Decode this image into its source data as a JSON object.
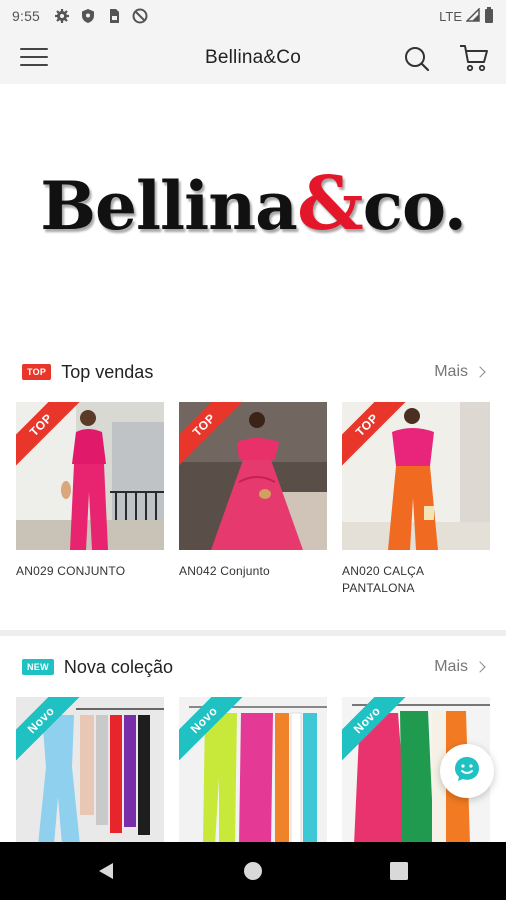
{
  "status_bar": {
    "time": "9:55",
    "network": "LTE",
    "icons": [
      "gear-icon",
      "shield-icon",
      "sim-card-icon",
      "do-not-disturb-icon"
    ]
  },
  "app_bar": {
    "title": "Bellina&Co",
    "menu_icon": "hamburger-menu-icon",
    "search_icon": "search-icon",
    "cart_icon": "shopping-cart-icon"
  },
  "banner": {
    "logo_text_main": "Bellina",
    "logo_text_amp": "&",
    "logo_text_tail": "co.",
    "colors": {
      "text": "#111111",
      "ampersand": "#e3162a"
    }
  },
  "sections": [
    {
      "tag": "TOP",
      "title": "Top vendas",
      "more_label": "Mais",
      "ribbon": "TOP",
      "products": [
        {
          "name": "AN029 CONJUNTO"
        },
        {
          "name": "AN042 Conjunto"
        },
        {
          "name": "AN020 CALÇA PANTALONA"
        }
      ]
    },
    {
      "tag": "NEW",
      "title": "Nova coleção",
      "more_label": "Mais",
      "ribbon": "Novo",
      "products": [
        {
          "name": ""
        },
        {
          "name": ""
        },
        {
          "name": ""
        }
      ]
    }
  ],
  "colors": {
    "top_accent": "#e8362a",
    "new_accent": "#1fc1c3",
    "chat_accent": "#1fc1c3"
  },
  "chat_button": {
    "icon": "chat-bubble-icon"
  },
  "nav_bar": {
    "icons": [
      "back-icon",
      "home-icon",
      "recents-icon"
    ]
  }
}
